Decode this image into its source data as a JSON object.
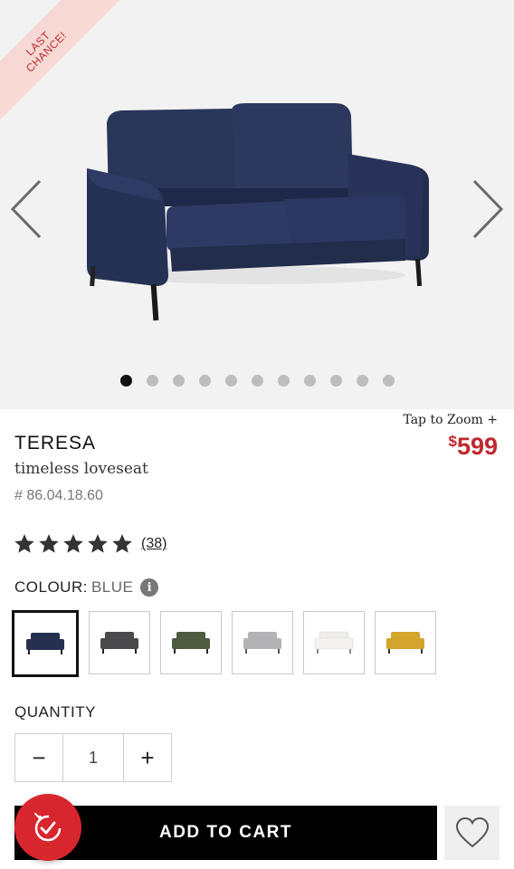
{
  "gallery": {
    "badge": "LAST CHANCE!",
    "slide_count": 11,
    "active_slide": 1
  },
  "product": {
    "zoom_label": "Tap to Zoom +",
    "price_symbol": "$",
    "price_value": "599",
    "title": "TERESA",
    "subtitle": "timeless loveseat",
    "sku": "# 86.04.18.60",
    "rating_stars": 5,
    "rating_count": "(38)"
  },
  "colour": {
    "label": "COLOUR:",
    "value": "BLUE",
    "info_icon": "i",
    "swatches": [
      {
        "name": "blue",
        "color": "#25304f",
        "selected": true
      },
      {
        "name": "dark-grey",
        "color": "#4a4a4c"
      },
      {
        "name": "green",
        "color": "#4f5b41"
      },
      {
        "name": "light-grey",
        "color": "#b3b3b5"
      },
      {
        "name": "white",
        "color": "#f1f0ee"
      },
      {
        "name": "yellow",
        "color": "#d3a52c"
      }
    ]
  },
  "quantity": {
    "label": "QUANTITY",
    "minus": "−",
    "value": "1",
    "plus": "+"
  },
  "actions": {
    "add_to_cart": "ADD TO CART"
  },
  "colors": {
    "accent": "#c0282d",
    "fab": "#d8262e",
    "sofa": "#25304f"
  }
}
